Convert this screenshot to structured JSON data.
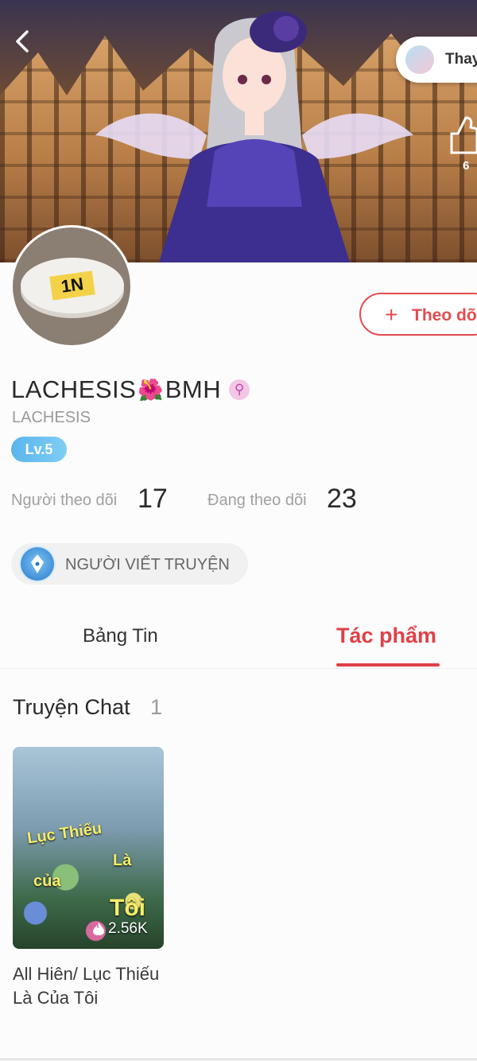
{
  "header": {
    "visitor_label": "Thay",
    "like_count": "6"
  },
  "profile": {
    "avatar_text": "1N",
    "display_name_part1": "LACHESIS",
    "display_name_emoji": "🌺",
    "display_name_part2": "BMH",
    "gender_symbol": "⚲",
    "username": "LACHESIS",
    "level": "Lv.5",
    "follow_label": "Theo dõi",
    "followers_label": "Người theo dõi",
    "followers_count": "17",
    "following_label": "Đang theo dõi",
    "following_count": "23",
    "role_label": "NGƯỜI VIẾT TRUYỆN"
  },
  "tabs": {
    "feed": "Bảng Tin",
    "works": "Tác phẩm",
    "active": "works"
  },
  "section": {
    "title": "Truyện Chat",
    "count": "1"
  },
  "stories": [
    {
      "cover_line1": "Lục Thiếu",
      "cover_line2": "Là",
      "cover_line3": "của",
      "cover_line4": "Tôi",
      "views": "2.56K",
      "title": "All Hiên/ Lục Thiếu Là Của Tôi"
    }
  ],
  "colors": {
    "accent": "#e04048",
    "level": "#5bb5ec",
    "gender": "#c148a9"
  }
}
